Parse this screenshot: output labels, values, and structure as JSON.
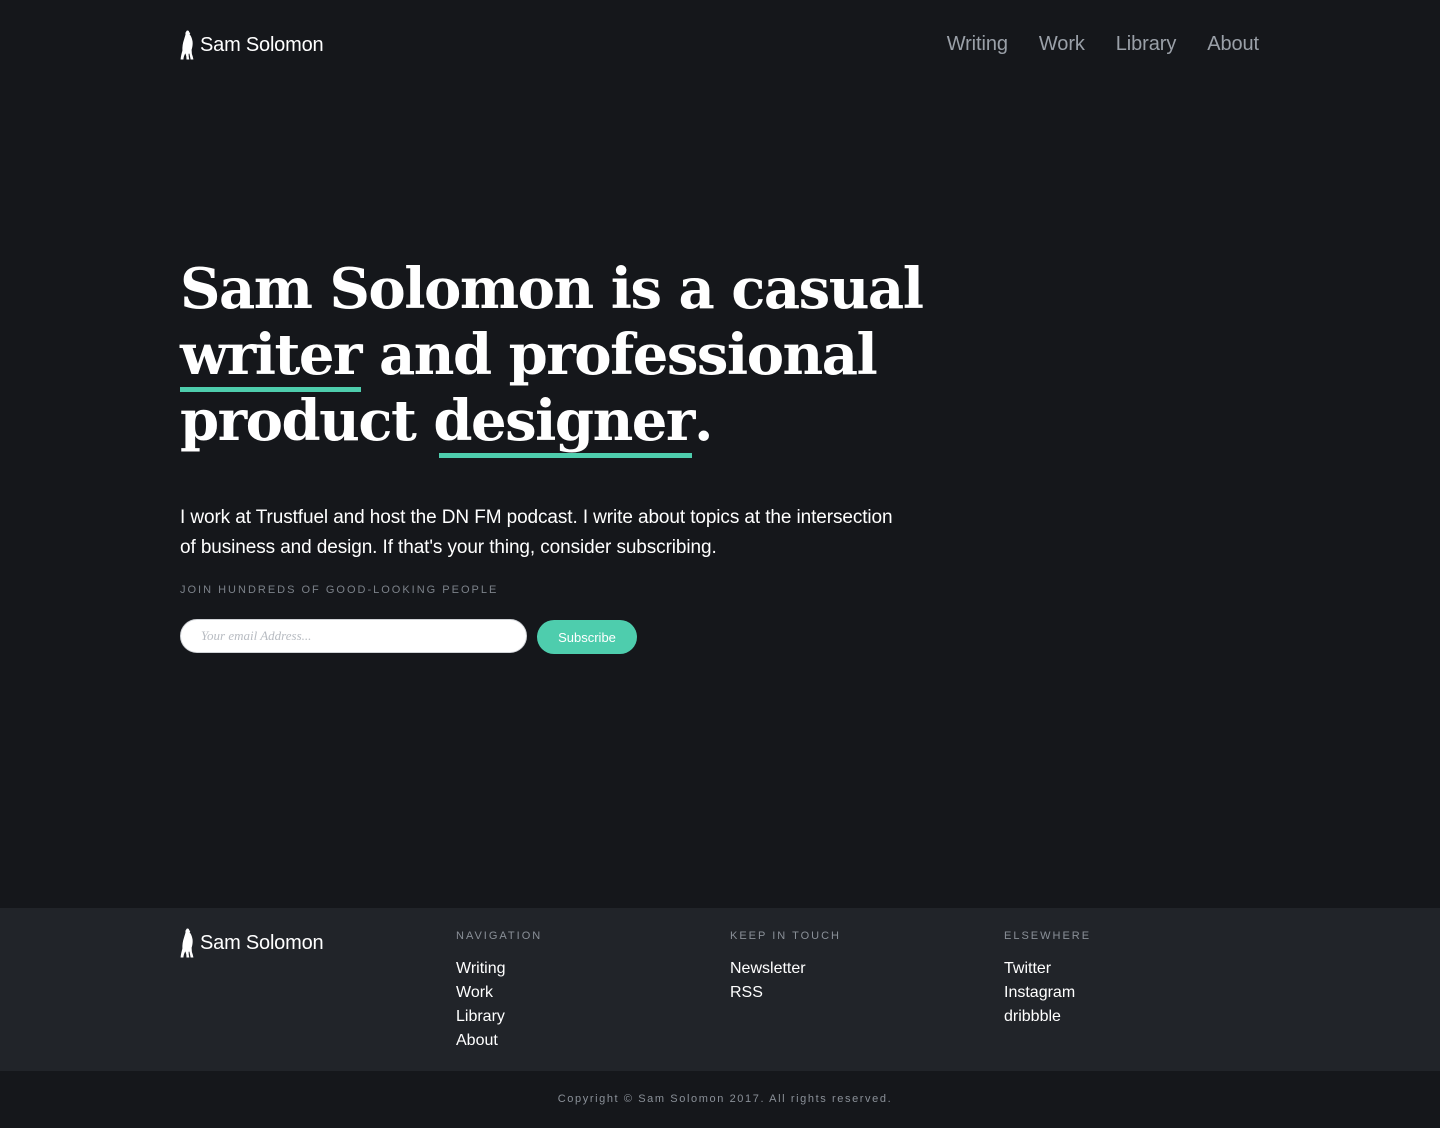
{
  "header": {
    "brand": "Sam Solomon",
    "nav": [
      "Writing",
      "Work",
      "Library",
      "About"
    ]
  },
  "hero": {
    "title_part1": "Sam Solomon is a casual",
    "title_word_writer": "writer",
    "title_part2": " and professional",
    "title_part3": "product ",
    "title_word_designer": "designer",
    "title_end": ".",
    "intro": "I  work at Trustfuel and host the DN FM podcast.  I write about topics at the intersection of business and design. If that's your thing, consider subscribing.",
    "join_label": "JOIN HUNDREDS OF GOOD-LOOKING PEOPLE",
    "email_placeholder": "Your email Address...",
    "subscribe_label": "Subscribe"
  },
  "footer": {
    "brand": "Sam Solomon",
    "columns": [
      {
        "heading": "NAVIGATION",
        "links": [
          "Writing",
          "Work",
          "Library",
          "About"
        ]
      },
      {
        "heading": "KEEP IN TOUCH",
        "links": [
          "Newsletter",
          "RSS"
        ]
      },
      {
        "heading": "ELSEWHERE",
        "links": [
          "Twitter",
          "Instagram",
          "dribbble"
        ]
      }
    ],
    "copyright": "Copyright © Sam Solomon 2017. All rights reserved."
  },
  "colors": {
    "background": "#15171b",
    "footer_background": "#212429",
    "accent": "#4ecdad"
  },
  "icons": {
    "logo": "bear-icon"
  }
}
